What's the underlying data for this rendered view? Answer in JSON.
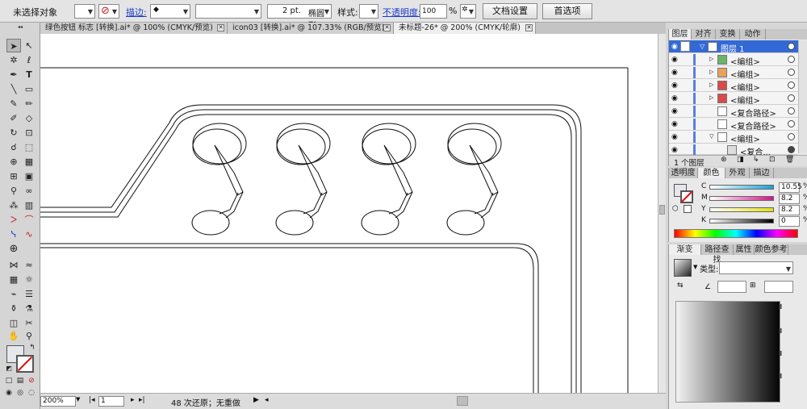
{
  "control_bar": {
    "selection_status": "未选择对象",
    "stroke_label": "描边:",
    "stroke_weight": "2 pt.",
    "brush_shape": "椭圆形",
    "style_label": "样式:",
    "opacity_label": "不透明度:",
    "opacity_value": "100",
    "opacity_unit": "%",
    "doc_setup_button": "文档设置",
    "prefs_button": "首选项"
  },
  "tabs": [
    {
      "label": "绿色按钮 标志 [转换].ai* @ 100% (CMYK/预览)"
    },
    {
      "label": "icon03 [转换].ai* @ 107.33% (RGB/预览)"
    },
    {
      "label": "未标题-26* @ 200% (CMYK/轮廓)"
    }
  ],
  "status_bar": {
    "zoom": "200%",
    "artboard": "1",
    "status_text": "48 次还原；无重做"
  },
  "layers_panel": {
    "tabs": [
      "图层",
      "对齐",
      "变换",
      "动作"
    ],
    "rows": [
      {
        "name": "图层 1"
      },
      {
        "name": "<编组>"
      },
      {
        "name": "<编组>"
      },
      {
        "name": "<编组>"
      },
      {
        "name": "<编组>"
      },
      {
        "name": "<复合路径>"
      },
      {
        "name": "<复合路径>"
      },
      {
        "name": "<编组>"
      },
      {
        "name": "<复合..."
      }
    ],
    "footer": "1 个图层"
  },
  "color_panel": {
    "tabs": [
      "透明度",
      "颜色",
      "外观",
      "描边"
    ],
    "channels": [
      {
        "label": "C",
        "value": "10.55",
        "unit": "%",
        "color": "#16a3d8"
      },
      {
        "label": "M",
        "value": "8.2",
        "unit": "%",
        "color": "#d8148c"
      },
      {
        "label": "Y",
        "value": "8.2",
        "unit": "%",
        "color": "#e3de12"
      },
      {
        "label": "K",
        "value": "0",
        "unit": "%",
        "color": "#222222"
      }
    ]
  },
  "gradient_panel": {
    "tabs": [
      "渐变",
      "路径查找",
      "属性",
      "颜色参考"
    ],
    "type_label": "类型:"
  }
}
